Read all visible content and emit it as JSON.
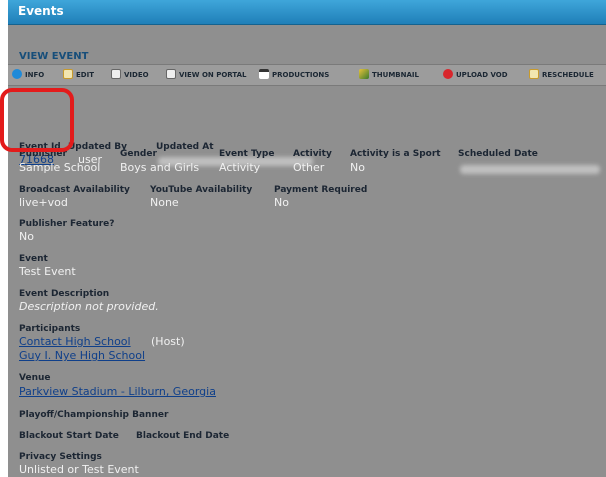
{
  "window": {
    "title": "Events"
  },
  "page": {
    "section_title": "VIEW EVENT"
  },
  "toolbar": [
    {
      "label": "INFO",
      "icon": "info-icon"
    },
    {
      "label": "EDIT",
      "icon": "edit-icon"
    },
    {
      "label": "VIDEO",
      "icon": "video-icon"
    },
    {
      "label": "VIEW ON PORTAL",
      "icon": "portal-icon"
    },
    {
      "label": "PRODUCTIONS",
      "icon": "productions-icon"
    },
    {
      "label": "THUMBNAIL",
      "icon": "thumbnail-icon"
    },
    {
      "label": "UPLOAD VOD",
      "icon": "upload-icon"
    },
    {
      "label": "RESCHEDULE",
      "icon": "reschedule-icon"
    }
  ],
  "labels": {
    "event_id": "Event Id",
    "updated_by": "Updated By",
    "updated_at": "Updated At",
    "publisher": "Publisher",
    "gender": "Gender",
    "event_type": "Event Type",
    "activity": "Activity",
    "activity_is_sport": "Activity is a Sport",
    "scheduled_date": "Scheduled Date",
    "broadcast_availability": "Broadcast Availability",
    "youtube_availability": "YouTube Availability",
    "payment_required": "Payment Required",
    "publisher_feature": "Publisher Feature?",
    "event": "Event",
    "event_description": "Event Description",
    "participants": "Participants",
    "venue": "Venue",
    "playoff_banner": "Playoff/Championship Banner",
    "blackout_start": "Blackout Start Date",
    "blackout_end": "Blackout End Date",
    "privacy_settings": "Privacy Settings"
  },
  "values": {
    "event_id": "71668",
    "updated_by": "user",
    "publisher": "Sample School",
    "gender": "Boys and Girls",
    "event_type": "Activity",
    "activity": "Other",
    "activity_is_sport": "No",
    "broadcast_availability": "live+vod",
    "youtube_availability": "None",
    "payment_required": "No",
    "publisher_feature": "No",
    "event": "Test Event",
    "event_description": "Description not provided.",
    "participants": [
      {
        "name": "Contact High School",
        "suffix": "(Host)"
      },
      {
        "name": "Guy I. Nye High School",
        "suffix": ""
      }
    ],
    "venue": "Parkview Stadium - Lilburn, Georgia",
    "privacy_settings": "Unlisted or Test Event"
  },
  "colors": {
    "title_bar": "#2a8fc9",
    "panel_bg": "#8f8f8f",
    "link": "#0f3f8a",
    "highlight": "#e31b1b"
  }
}
